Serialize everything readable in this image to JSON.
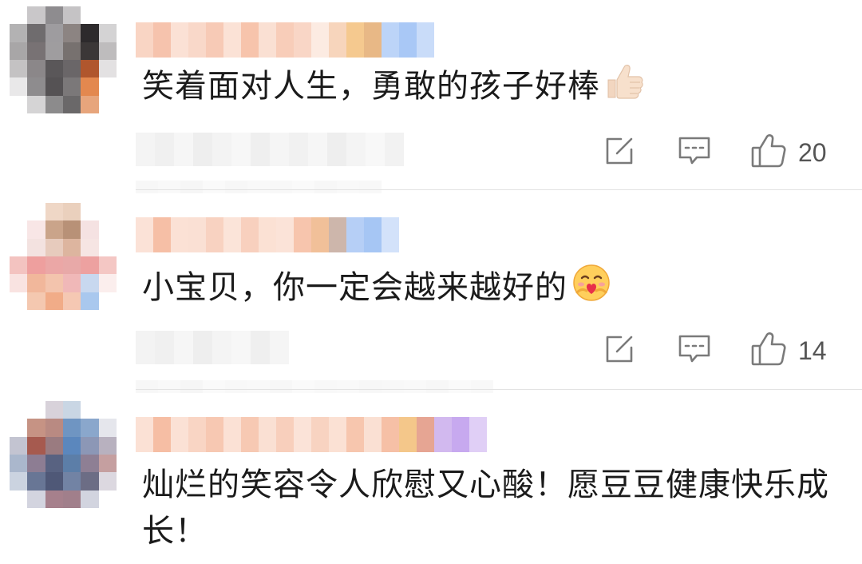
{
  "comments": [
    {
      "text": "笑着面对人生，勇敢的孩子好棒",
      "emoji": "thumbs-up",
      "like_count": "20"
    },
    {
      "text": "小宝贝，你一定会越来越好的",
      "emoji": "hugging-face",
      "like_count": "14"
    },
    {
      "text": "灿烂的笑容令人欣慰又心酸！愿豆豆健康快乐成长！",
      "emoji": "",
      "like_count": ""
    }
  ],
  "icons": {
    "share": "share-icon",
    "reply": "comment-icon",
    "like": "thumbs-up-icon"
  },
  "colors": {
    "icon": "#7a7a7a",
    "divider": "#e3e3e3",
    "text": "#1b1b1b"
  }
}
